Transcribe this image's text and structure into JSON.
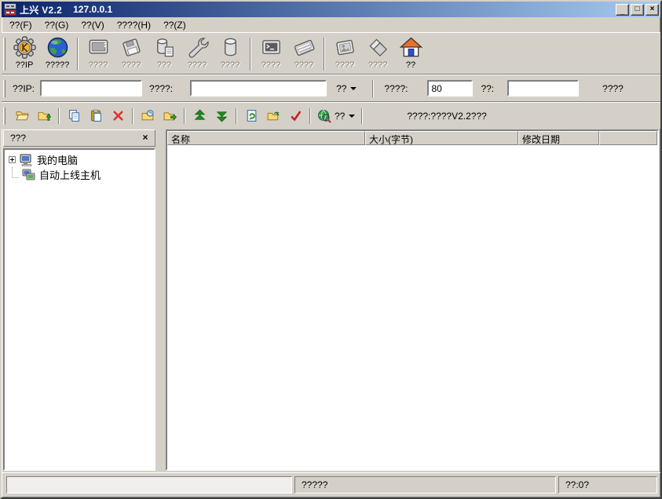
{
  "titlebar": {
    "title": "上兴 V2.2",
    "host": "127.0.0.1",
    "minimize_glyph": "_",
    "maximize_glyph": "□",
    "close_glyph": "×"
  },
  "menu": {
    "items": [
      {
        "label": "??(F)"
      },
      {
        "label": "??(G)"
      },
      {
        "label": "??(V)"
      },
      {
        "label": "????(H)"
      },
      {
        "label": "??(Z)"
      }
    ]
  },
  "main_toolbar": {
    "buttons": [
      {
        "label": "??IP",
        "icon": "gear-icon",
        "enabled": true
      },
      {
        "label": "?????",
        "icon": "globe-icon",
        "enabled": true
      },
      {
        "label": "????",
        "icon": "monitor-icon",
        "enabled": false
      },
      {
        "label": "????",
        "icon": "floppy-icon",
        "enabled": false
      },
      {
        "label": "???",
        "icon": "storage-page-icon",
        "enabled": false
      },
      {
        "label": "????",
        "icon": "wrench-icon",
        "enabled": false
      },
      {
        "label": "????",
        "icon": "database-icon",
        "enabled": false
      },
      {
        "label": "????",
        "icon": "terminal-icon",
        "enabled": false
      },
      {
        "label": "????",
        "icon": "keyboard-icon",
        "enabled": false
      },
      {
        "label": "????",
        "icon": "picture-icon",
        "enabled": false
      },
      {
        "label": "????",
        "icon": "disks-icon",
        "enabled": false
      },
      {
        "label": "??",
        "icon": "home-icon",
        "enabled": true
      }
    ]
  },
  "address_bar": {
    "ip_label": "??IP:",
    "ip_value": "",
    "domain_label": "????:",
    "domain_value": "",
    "resolve_label": "??",
    "port_label": "????:",
    "port_value": "80",
    "pass_label": "??:",
    "pass_value": "",
    "connect_label": "????"
  },
  "quick_bar": {
    "icons": [
      "folder-open-icon",
      "folder-up-icon",
      "copy-icon",
      "paste-icon",
      "delete-icon",
      "folder-view-icon",
      "folder-send-icon",
      "upload-icon",
      "download-icon",
      "refresh-icon",
      "folder-go-icon",
      "confirm-icon",
      "web-search-icon"
    ],
    "search_label": "??",
    "status_text": "????:????V2.2???"
  },
  "sidebar": {
    "header": "???",
    "close_glyph": "×",
    "items": [
      {
        "label": "我的电脑",
        "icon": "computer-icon"
      },
      {
        "label": "自动上线主机",
        "icon": "network-host-icon"
      }
    ]
  },
  "file_list": {
    "columns": [
      {
        "label": "名称"
      },
      {
        "label": "大小(字节)"
      },
      {
        "label": "修改日期"
      },
      {
        "label": ""
      }
    ],
    "rows": []
  },
  "status_bar": {
    "message": "?????",
    "transfer": "??:0?"
  },
  "colors": {
    "titlebar_start": "#0a246a",
    "titlebar_end": "#a6caf0",
    "chrome": "#d4d0c8",
    "disabled_text": "#848078",
    "panel_background": "#ffffff"
  }
}
